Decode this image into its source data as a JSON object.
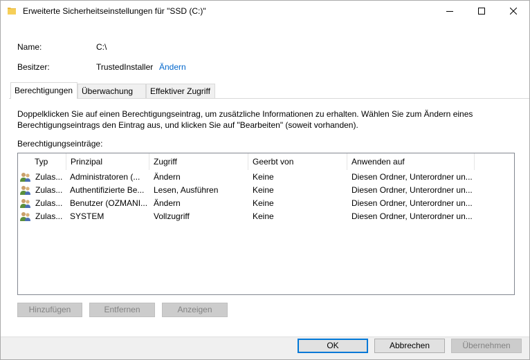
{
  "window": {
    "title": "Erweiterte Sicherheitseinstellungen für \"SSD (C:)\""
  },
  "info": {
    "name_label": "Name:",
    "name_value": "C:\\",
    "owner_label": "Besitzer:",
    "owner_value": "TrustedInstaller",
    "change_link": "Ändern"
  },
  "tabs": [
    {
      "label": "Berechtigungen",
      "active": true
    },
    {
      "label": "Überwachung",
      "active": false
    },
    {
      "label": "Effektiver Zugriff",
      "active": false
    }
  ],
  "description": "Doppelklicken Sie auf einen Berechtigungseintrag, um zusätzliche Informationen zu erhalten. Wählen Sie zum Ändern eines Berechtigungseintrags den Eintrag aus, und klicken Sie auf \"Bearbeiten\" (soweit vorhanden).",
  "entries_label": "Berechtigungseinträge:",
  "columns": [
    "Typ",
    "Prinzipal",
    "Zugriff",
    "Geerbt von",
    "Anwenden auf"
  ],
  "rows": [
    {
      "type": "Zulas...",
      "principal": "Administratoren (...",
      "access": "Ändern",
      "inherited": "Keine",
      "applies": "Diesen Ordner, Unterordner un..."
    },
    {
      "type": "Zulas...",
      "principal": "Authentifizierte Be...",
      "access": "Lesen, Ausführen",
      "inherited": "Keine",
      "applies": "Diesen Ordner, Unterordner un..."
    },
    {
      "type": "Zulas...",
      "principal": "Benutzer (OZMANI...",
      "access": "Ändern",
      "inherited": "Keine",
      "applies": "Diesen Ordner, Unterordner un..."
    },
    {
      "type": "Zulas...",
      "principal": "SYSTEM",
      "access": "Vollzugriff",
      "inherited": "Keine",
      "applies": "Diesen Ordner, Unterordner un..."
    }
  ],
  "buttons": {
    "add": "Hinzufügen",
    "remove": "Entfernen",
    "view": "Anzeigen",
    "ok": "OK",
    "cancel": "Abbrechen",
    "apply": "Übernehmen"
  },
  "icons": {
    "title": "folder-icon",
    "row": "users-icon"
  },
  "colors": {
    "link": "#0066cc",
    "accent": "#0078d7",
    "folder": "#e8b739"
  }
}
